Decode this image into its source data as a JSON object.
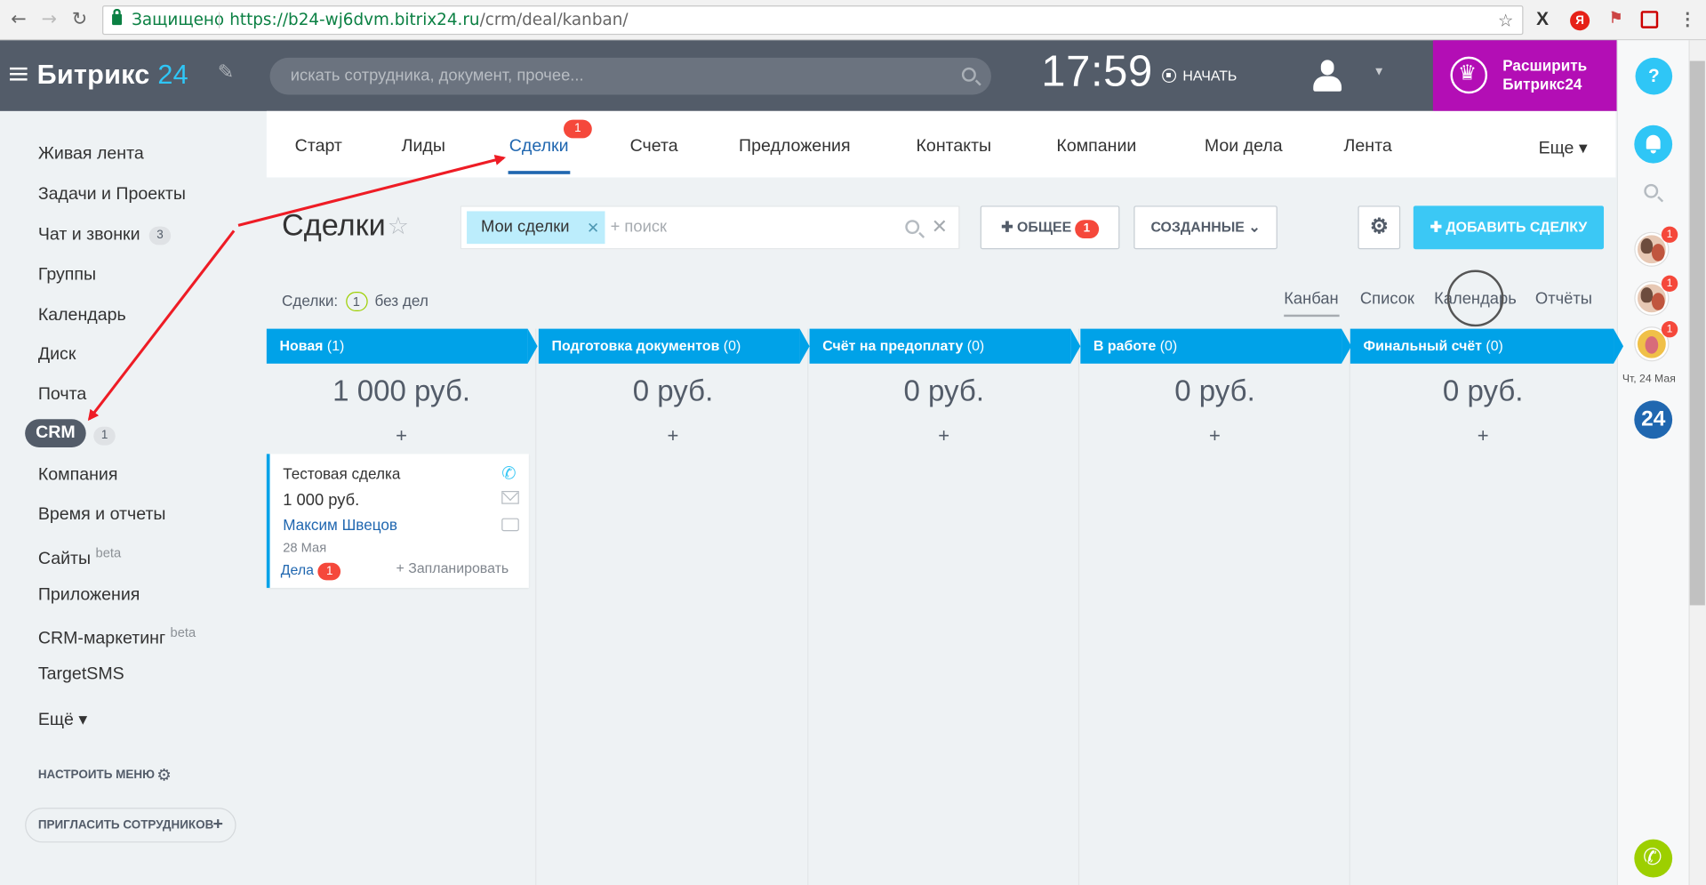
{
  "browser": {
    "secure_label": "Защищено",
    "url_host": "https://b24-wj6dvm.bitrix24.ru",
    "url_path": "/crm/deal/kanban/",
    "ext_icons": [
      "x-extension-icon",
      "yandex-icon",
      "pdf-icon",
      "bookmark-icon"
    ]
  },
  "header": {
    "logo_text": "Битрикс",
    "logo_num": "24",
    "search_placeholder": "искать сотрудника, документ, прочее...",
    "time": "17:59",
    "start_label": "НАЧАТЬ",
    "expand_label_1": "Расширить",
    "expand_label_2": "Битрикс24",
    "help_label": "?"
  },
  "sidebar": {
    "items": [
      {
        "label": "Живая лента"
      },
      {
        "label": "Задачи и Проекты"
      },
      {
        "label": "Чат и звонки",
        "count": "3"
      },
      {
        "label": "Группы"
      },
      {
        "label": "Календарь"
      },
      {
        "label": "Диск"
      },
      {
        "label": "Почта"
      },
      {
        "label": "CRM",
        "count": "1"
      },
      {
        "label": "Компания"
      },
      {
        "label": "Время и отчеты"
      },
      {
        "label": "Сайты",
        "sup": "beta"
      },
      {
        "label": "Приложения"
      },
      {
        "label": "CRM-маркетинг",
        "sup": "beta"
      },
      {
        "label": "TargetSMS"
      },
      {
        "label": "Ещё ▾"
      }
    ],
    "setup_label": "НАСТРОИТЬ МЕНЮ",
    "invite_label": "ПРИГЛАСИТЬ СОТРУДНИКОВ"
  },
  "tabs": {
    "items": [
      "Старт",
      "Лиды",
      "Сделки",
      "Счета",
      "Предложения",
      "Контакты",
      "Компании",
      "Мои дела",
      "Лента",
      "Еще ▾"
    ],
    "active": "Сделки",
    "badge": "1"
  },
  "toolbar": {
    "title": "Сделки",
    "filter_chip": "Мои сделки",
    "filter_placeholder": "+ поиск",
    "btn_all": "ОБЩЕЕ",
    "btn_all_badge": "1",
    "btn_created": "СОЗДАННЫЕ",
    "btn_add": "ДОБАВИТЬ СДЕЛКУ"
  },
  "stats": {
    "label": "Сделки:",
    "count": "1",
    "suffix": "без дел"
  },
  "views": [
    "Канбан",
    "Список",
    "Календарь",
    "Отчёты"
  ],
  "kanban": {
    "columns": [
      {
        "name": "Новая",
        "count": "(1)",
        "sum": "1 000 руб."
      },
      {
        "name": "Подготовка документов",
        "count": "(0)",
        "sum": "0 руб."
      },
      {
        "name": "Счёт на предоплату",
        "count": "(0)",
        "sum": "0 руб."
      },
      {
        "name": "В работе",
        "count": "(0)",
        "sum": "0 руб."
      },
      {
        "name": "Финальный счёт",
        "count": "(0)",
        "sum": "0 руб."
      }
    ],
    "card": {
      "title": "Тестовая сделка",
      "sum": "1 000 руб.",
      "client": "Максим Швецов",
      "date": "28 Мая",
      "tasks_label": "Дела",
      "tasks_badge": "1",
      "plan_label": "+ Запланировать"
    }
  },
  "rightbar": {
    "avatar_badges": [
      "1",
      "1",
      "1"
    ],
    "date_label": "Чт, 24 Мая",
    "b24_label": "24"
  },
  "colors": {
    "header_bg": "#535c69",
    "accent_blue": "#2fc6f6",
    "column_blue": "#00a2e8",
    "expand_purple": "#b30eb5",
    "badge_red": "#f5483b",
    "link_blue": "#2067b0",
    "annotation_red": "#ee1c25"
  }
}
